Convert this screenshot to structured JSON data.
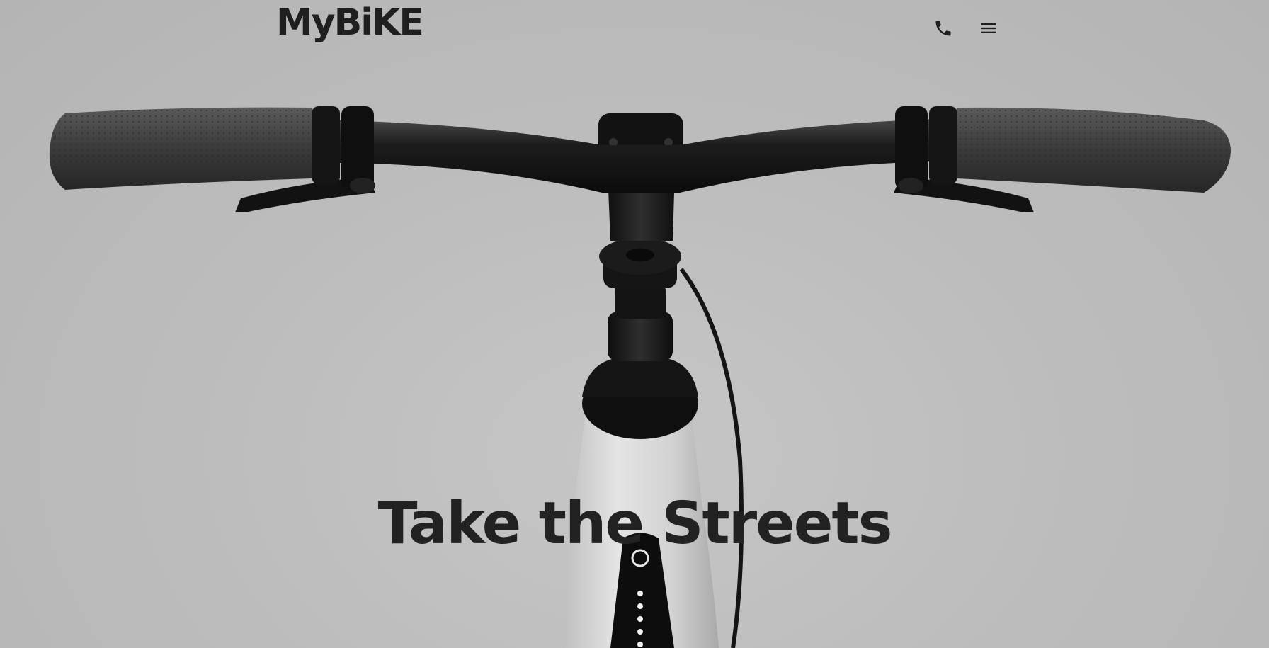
{
  "header": {
    "logo_text": "MyBiKE",
    "phone_icon": "phone-icon",
    "menu_icon": "hamburger-menu-icon"
  },
  "hero": {
    "headline": "Take the Streets",
    "image": "bicycle-handlebar-front-view"
  },
  "colors": {
    "background": "#bcbcbc",
    "text": "#1f1f1f",
    "bike_black": "#151515",
    "frame_white": "#d8d8d8"
  }
}
